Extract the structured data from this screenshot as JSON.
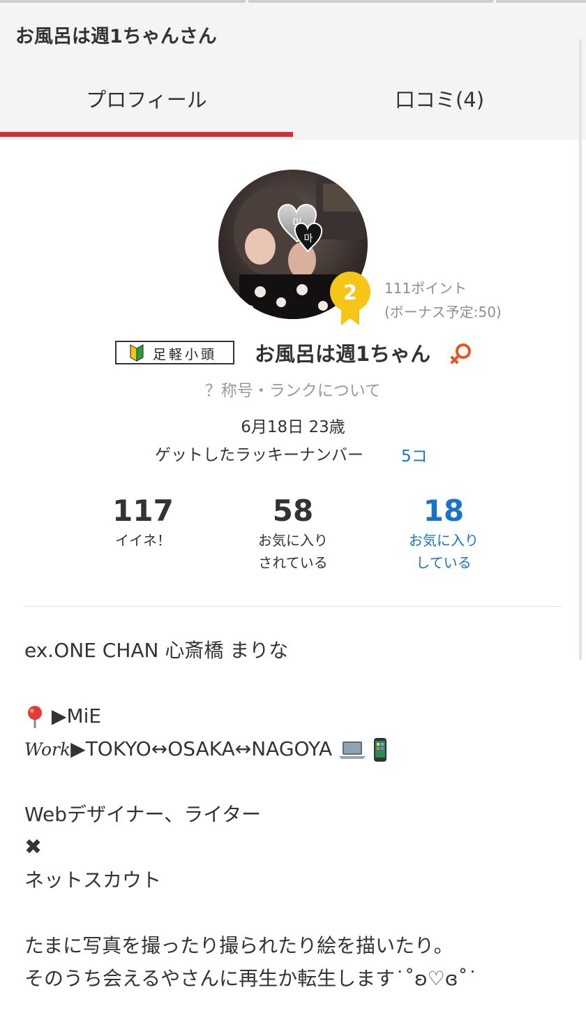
{
  "header": {
    "title": "お風呂は週1ちゃんさん"
  },
  "tabs": {
    "profile_label": "プロフィール",
    "reviews_label": "口コミ(4)",
    "active": "profile"
  },
  "colors": {
    "accent_red": "#d32f2f",
    "link_blue": "#1a73c9",
    "medal_yellow": "#f5c518",
    "female_orange": "#e8541d"
  },
  "profile": {
    "rank_badge_text": "足軽小頭",
    "rank_badge_icon": "beginner-mark-icon",
    "name": "お風呂は週1ちゃん",
    "gender_icon": "female-icon",
    "medal_number": "2",
    "points": "111ポイント",
    "bonus": "(ボーナス予定:50)",
    "rank_help": "？称号・ランクについて",
    "birthday_age": "6月18日 23歳",
    "lucky_label": "ゲットしたラッキーナンバー",
    "lucky_count": "5コ",
    "avatar_overlay": [
      "미",
      "마"
    ]
  },
  "stats": {
    "likes": {
      "value": "117",
      "label": "イイネ！"
    },
    "favorited": {
      "value": "58",
      "label_line1": "お気に入り",
      "label_line2": "されている"
    },
    "favoriting": {
      "value": "18",
      "label_line1": "お気に入り",
      "label_line2": "している"
    }
  },
  "bio": {
    "line1": "ex.ONE CHAN 心斎橋 まりな",
    "line2_text": "▶MiE",
    "line2_icon": "round-pushpin-icon",
    "line3_work": "Work",
    "line3_text": "▶TOKYO↔OSAKA↔NAGOYA",
    "line3_icons": [
      "laptop-icon",
      "mobile-phone-icon"
    ],
    "line4": "Webデザイナー、ライター",
    "line5_icon": "heavy-multiplication-x-icon",
    "line5_glyph": "✖",
    "line6": "ネットスカウト",
    "line7": "たまに写真を撮ったり撮られたり絵を描いたり。",
    "line8": "そのうち会えるやさんに再生か転生します˙˚ʚ♡ɞ˚˙"
  }
}
